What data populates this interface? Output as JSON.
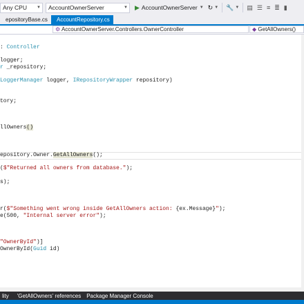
{
  "toolbar": {
    "platform": "Any CPU",
    "project": "AccountOwnerServer",
    "run_target": "AccountOwnerServer",
    "run_icon": "play-icon",
    "refresh_icon": "refresh-icon"
  },
  "tabs": [
    {
      "label": "epositoryBase.cs"
    },
    {
      "label": "AccountRepository.cs"
    }
  ],
  "navbar": {
    "class_path": "AccountOwnerServer.Controllers.OwnerController",
    "member": "GetAllOwners()"
  },
  "code": {
    "l1_a": ": ",
    "l1_b": "Controller",
    "l2": "logger;",
    "l3_a": "r",
    "l3_b": " _repository;",
    "l4_a": "LoggerManager",
    "l4_b": " logger, ",
    "l4_c": "IRepositoryWrapper",
    "l4_d": " repository)",
    "l5": "tory;",
    "l6_a": "llOwners",
    "l6_b": "()",
    "l7_a": "epository.Owner.",
    "l7_b": "GetAllOwners",
    "l7_c": "();",
    "l8_a": "(",
    "l8_b": "$\"Returned all owners from database.\"",
    "l8_c": ");",
    "l9": "s);",
    "l10_a": "r(",
    "l10_b": "$\"Something went wrong inside GetAllOwners action: ",
    "l10_c": "{ex.Message}",
    "l10_d": "\"",
    "l10_e": ");",
    "l11_a": "e(",
    "l11_b": "500",
    "l11_c": ", ",
    "l11_d": "\"Internal server error\"",
    "l11_e": ");",
    "l12_a": "\"OwnerById\"",
    "l12_b": ")]",
    "l13_a": "OwnerById(",
    "l13_b": "Guid",
    "l13_c": " id)"
  },
  "bottom_tabs": [
    {
      "label": "lity"
    },
    {
      "label": "'GetAllOwners' references"
    },
    {
      "label": "Package Manager Console"
    }
  ],
  "colors": {
    "accent": "#007acc",
    "keyword": "#0000ff",
    "type": "#2b91af",
    "string": "#a31515"
  }
}
